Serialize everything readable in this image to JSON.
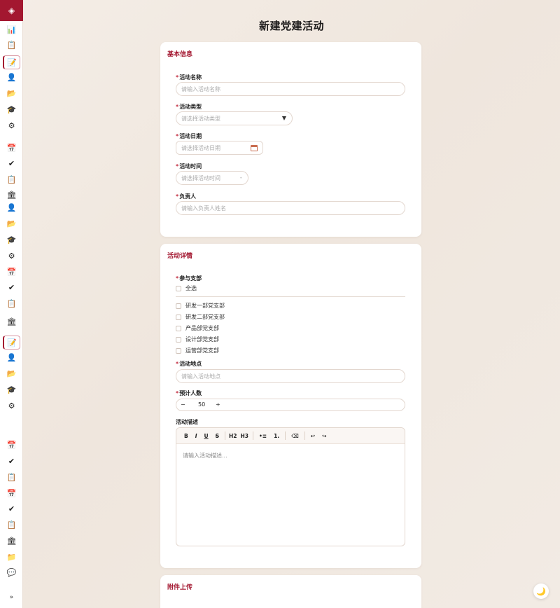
{
  "page": {
    "title": "新建党建活动"
  },
  "sidebar": {
    "logo_icon": "◈",
    "toggle_label": "»",
    "icons": [
      {
        "name": "chart-icon",
        "glyph": "📊"
      },
      {
        "name": "clipboard-icon",
        "glyph": "📋"
      },
      {
        "name": "edit-document-icon",
        "glyph": "📝"
      },
      {
        "name": "user-icon",
        "glyph": "👤"
      },
      {
        "name": "folder-icon",
        "glyph": "📂"
      },
      {
        "name": "graduation-cap-icon",
        "glyph": "🎓"
      },
      {
        "name": "settings-icon",
        "glyph": "⚙"
      },
      {
        "name": "calendar-icon",
        "glyph": "📅"
      },
      {
        "name": "check-icon",
        "glyph": "✔"
      },
      {
        "name": "clipboard-icon",
        "glyph": "📋"
      },
      {
        "name": "building-icon",
        "glyph": "🏛"
      },
      {
        "name": "user-icon",
        "glyph": "👤"
      },
      {
        "name": "folder-icon",
        "glyph": "📂"
      },
      {
        "name": "graduation-cap-icon",
        "glyph": "🎓"
      },
      {
        "name": "settings-icon",
        "glyph": "⚙"
      },
      {
        "name": "calendar-icon",
        "glyph": "📅"
      },
      {
        "name": "check-icon",
        "glyph": "✔"
      },
      {
        "name": "clipboard-icon",
        "glyph": "📋"
      },
      {
        "name": "building-icon",
        "glyph": "🏛"
      },
      {
        "name": "edit-document-icon",
        "glyph": "📝"
      },
      {
        "name": "user-icon",
        "glyph": "👤"
      },
      {
        "name": "folder-icon",
        "glyph": "📂"
      },
      {
        "name": "graduation-cap-icon",
        "glyph": "🎓"
      },
      {
        "name": "settings-icon",
        "glyph": "⚙"
      },
      {
        "name": "calendar-icon",
        "glyph": "📅"
      },
      {
        "name": "check-icon",
        "glyph": "✔"
      },
      {
        "name": "clipboard-icon",
        "glyph": "📋"
      },
      {
        "name": "calendar-icon",
        "glyph": "📅"
      },
      {
        "name": "check-icon",
        "glyph": "✔"
      },
      {
        "name": "clipboard-icon",
        "glyph": "📋"
      },
      {
        "name": "building-icon",
        "glyph": "🏛"
      },
      {
        "name": "folder-icon",
        "glyph": "📁"
      },
      {
        "name": "chat-icon",
        "glyph": "💬"
      }
    ]
  },
  "basic": {
    "title": "基本信息",
    "required_mark": "*",
    "name_label": "活动名称",
    "name_placeholder": "请输入活动名称",
    "type_label": "活动类型",
    "type_placeholder": "请选择活动类型",
    "type_caret": "▼",
    "date_label": "活动日期",
    "date_placeholder": "请选择活动日期",
    "time_label": "活动时间",
    "time_placeholder": "请选择活动时间",
    "time_caret": "•",
    "owner_label": "负责人",
    "owner_placeholder": "请输入负责人姓名"
  },
  "detail": {
    "title": "活动详情",
    "branch_label": "参与支部",
    "select_all": "全选",
    "branches": [
      "研发一部党支部",
      "研发二部党支部",
      "产品部党支部",
      "设计部党支部",
      "运营部党支部"
    ],
    "location_label": "活动地点",
    "location_placeholder": "请输入活动地点",
    "count_label": "预计人数",
    "count_minus": "−",
    "count_value": "50",
    "count_plus": "+",
    "desc_label": "活动描述",
    "desc_placeholder": "请输入活动描述...",
    "toolbar": {
      "bold": "B",
      "italic": "I",
      "underline": "U",
      "strike": "S",
      "h2": "H2",
      "h3": "H3",
      "bullet": "•≡",
      "ordered": "1.",
      "clear": "⌫",
      "undo": "↩",
      "redo": "↪"
    }
  },
  "upload": {
    "title": "附件上传"
  },
  "theme_toggle": "🌙"
}
